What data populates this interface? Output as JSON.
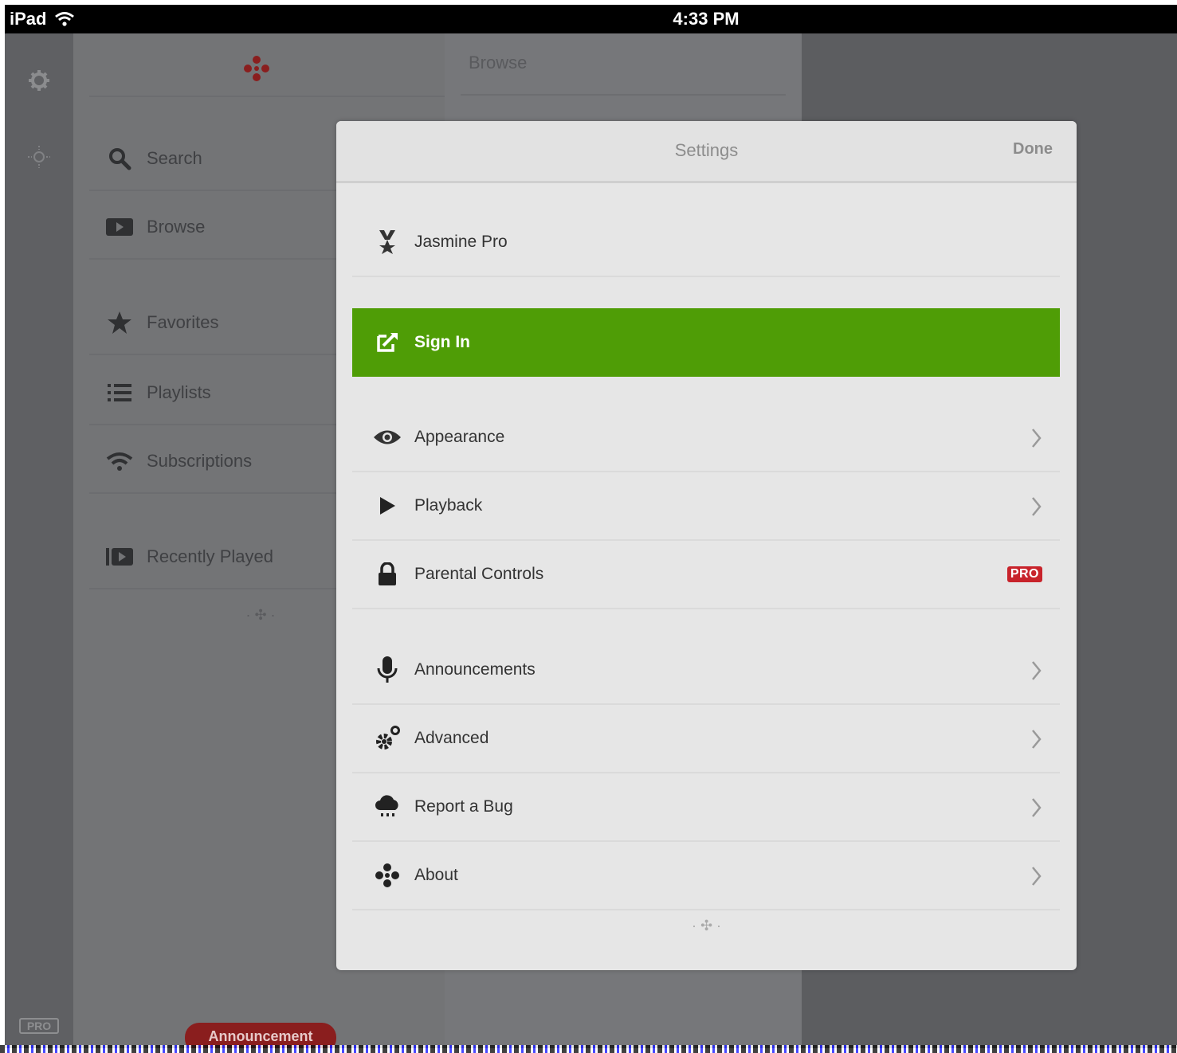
{
  "statusbar": {
    "device": "iPad",
    "time": "4:33 PM"
  },
  "rail": {
    "pro_label": "PRO"
  },
  "sidebar": {
    "items": [
      {
        "label": "Search",
        "icon": "search-icon"
      },
      {
        "label": "Browse",
        "icon": "browse-icon"
      },
      {
        "label": "Favorites",
        "icon": "star-icon"
      },
      {
        "label": "Playlists",
        "icon": "list-icon"
      },
      {
        "label": "Subscriptions",
        "icon": "wifi-icon"
      },
      {
        "label": "Recently Played",
        "icon": "recent-icon"
      }
    ],
    "announcement": "Announcement"
  },
  "browse": {
    "title": "Browse"
  },
  "modal": {
    "title": "Settings",
    "done": "Done",
    "rows": [
      {
        "label": "Jasmine Pro",
        "icon": "award-icon"
      },
      {
        "label": "Sign In",
        "icon": "sign-in-icon"
      },
      {
        "label": "Appearance",
        "icon": "eye-icon"
      },
      {
        "label": "Playback",
        "icon": "play-icon"
      },
      {
        "label": "Parental Controls",
        "icon": "lock-icon",
        "badge": "PRO"
      },
      {
        "label": "Announcements",
        "icon": "microphone-icon"
      },
      {
        "label": "Advanced",
        "icon": "gears-icon"
      },
      {
        "label": "Report a Bug",
        "icon": "bug-cloud-icon"
      },
      {
        "label": "About",
        "icon": "logo-icon"
      }
    ]
  },
  "colors": {
    "accent_green": "#4f9d06",
    "brand_red": "#8a1e1e",
    "pro_badge": "#c8232b"
  }
}
